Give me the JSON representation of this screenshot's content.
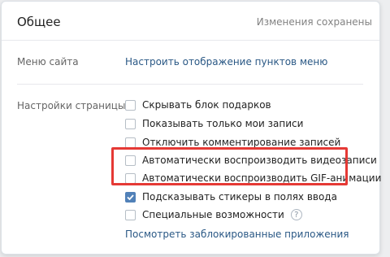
{
  "header": {
    "title": "Общее",
    "status": "Изменения сохранены"
  },
  "menu_section": {
    "label": "Меню сайта",
    "link": "Настроить отображение пунктов меню"
  },
  "page_settings": {
    "label": "Настройки страницы",
    "options": [
      {
        "label": "Скрывать блок подарков",
        "checked": false
      },
      {
        "label": "Показывать только мои записи",
        "checked": false
      },
      {
        "label": "Отключить комментирование записей",
        "checked": false
      },
      {
        "label": "Автоматически воспроизводить видеозаписи",
        "checked": false
      },
      {
        "label": "Автоматически воспроизводить GIF-анимации",
        "checked": false
      },
      {
        "label": "Подсказывать стикеры в полях ввода",
        "checked": true
      },
      {
        "label": "Специальные возможности",
        "checked": false
      }
    ],
    "help_icon": "question-icon",
    "help_glyph": "?",
    "blocked_apps_link": "Посмотреть заблокированные приложения"
  },
  "colors": {
    "accent": "#5181b8",
    "link": "#2a5885",
    "highlight": "#e53935"
  }
}
